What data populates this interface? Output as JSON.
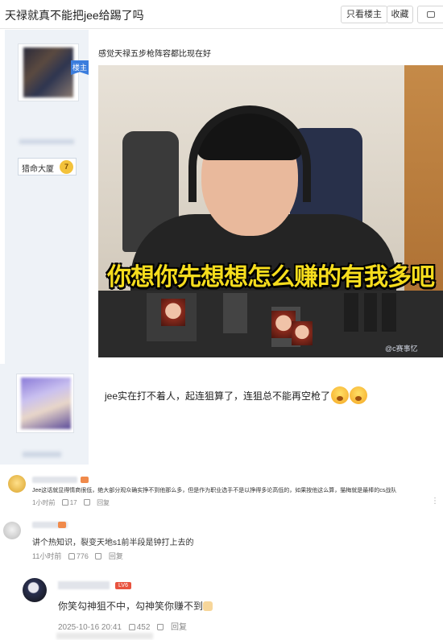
{
  "header": {
    "title": "天禄就真不能把jee给踢了吗",
    "only_owner_label": "只看楼主",
    "favorite_label": "收藏"
  },
  "post1": {
    "owner_badge": "楼主",
    "rank_label": "猎命大厦",
    "rank_level": "7",
    "text": "感觉天禄五步枪阵容都比现在好",
    "image_caption": "你想你先想想怎么赚的有我多吧",
    "image_watermark": "@c赛事忆"
  },
  "post2": {
    "text": "jee实在打不着人，起连狙算了，连狙总不能再空枪了"
  },
  "comments": [
    {
      "text": "Jee这话就显得情商很低，绝大部分观众确实挣不到他那么多，但是作为职业选手不是以挣得多论高低的，如果按他这么算，猫梅就是最棒的cs战队",
      "time": "1小时前",
      "likes": "17",
      "reply_label": "回复"
    },
    {
      "text": "讲个热知识，裂变天地s1前半段是钟打上去的",
      "time": "11小时前",
      "likes": "776",
      "reply_label": "回复"
    },
    {
      "level": "LV6",
      "text": "你笑勾神狙不中，勾神笑你赚不到",
      "time": "2025-10-16 20:41",
      "likes": "452",
      "reply_label": "回复"
    }
  ],
  "colors": {
    "accent_blue": "#3b7ddd",
    "caption_yellow": "#f6dd1d",
    "sidebar_bg": "#eef2f7"
  }
}
